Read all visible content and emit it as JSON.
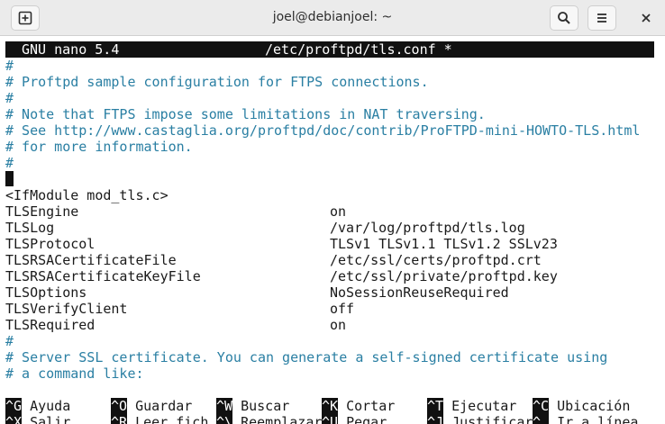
{
  "window": {
    "title": "joel@debianjoel: ~",
    "new_tab_icon": "new-tab-icon",
    "search_icon": "search-icon",
    "menu_icon": "hamburger-menu-icon",
    "close_icon": "close-icon"
  },
  "nano": {
    "version": "GNU nano 5.4",
    "filename": "/etc/proftpd/tls.conf *"
  },
  "lines": {
    "l1": "#",
    "l2": "# Proftpd sample configuration for FTPS connections.",
    "l3": "#",
    "l4": "# Note that FTPS impose some limitations in NAT traversing.",
    "l5": "# See http://www.castaglia.org/proftpd/doc/contrib/ProFTPD-mini-HOWTO-TLS.html",
    "l6": "# for more information.",
    "l7": "#",
    "l9": "<IfModule mod_tls.c>",
    "l19": "#",
    "l20": "# Server SSL certificate. You can generate a self-signed certificate using",
    "l21": "# a command like:"
  },
  "directives": [
    {
      "key": "TLSEngine",
      "value": "on"
    },
    {
      "key": "TLSLog",
      "value": "/var/log/proftpd/tls.log"
    },
    {
      "key": "TLSProtocol",
      "value": "TLSv1 TLSv1.1 TLSv1.2 SSLv23"
    },
    {
      "key": "TLSRSACertificateFile",
      "value": "/etc/ssl/certs/proftpd.crt"
    },
    {
      "key": "TLSRSACertificateKeyFile",
      "value": "/etc/ssl/private/proftpd.key"
    },
    {
      "key": "TLSOptions",
      "value": "NoSessionReuseRequired"
    },
    {
      "key": "TLSVerifyClient",
      "value": "off"
    },
    {
      "key": "TLSRequired",
      "value": "on"
    }
  ],
  "shortcuts": {
    "row1": [
      {
        "key": "^G",
        "label": "Ayuda"
      },
      {
        "key": "^O",
        "label": "Guardar"
      },
      {
        "key": "^W",
        "label": "Buscar"
      },
      {
        "key": "^K",
        "label": "Cortar"
      },
      {
        "key": "^T",
        "label": "Ejecutar"
      },
      {
        "key": "^C",
        "label": "Ubicación"
      }
    ],
    "row2": [
      {
        "key": "^X",
        "label": "Salir"
      },
      {
        "key": "^R",
        "label": "Leer fich."
      },
      {
        "key": "^\\",
        "label": "Reemplazar"
      },
      {
        "key": "^U",
        "label": "Pegar"
      },
      {
        "key": "^J",
        "label": "Justificar"
      },
      {
        "key": "^_",
        "label": "Ir a línea"
      }
    ]
  },
  "colors": {
    "comment": "#2a7fa3",
    "header_bg": "#111111",
    "titlebar_bg": "#ebebeb"
  }
}
